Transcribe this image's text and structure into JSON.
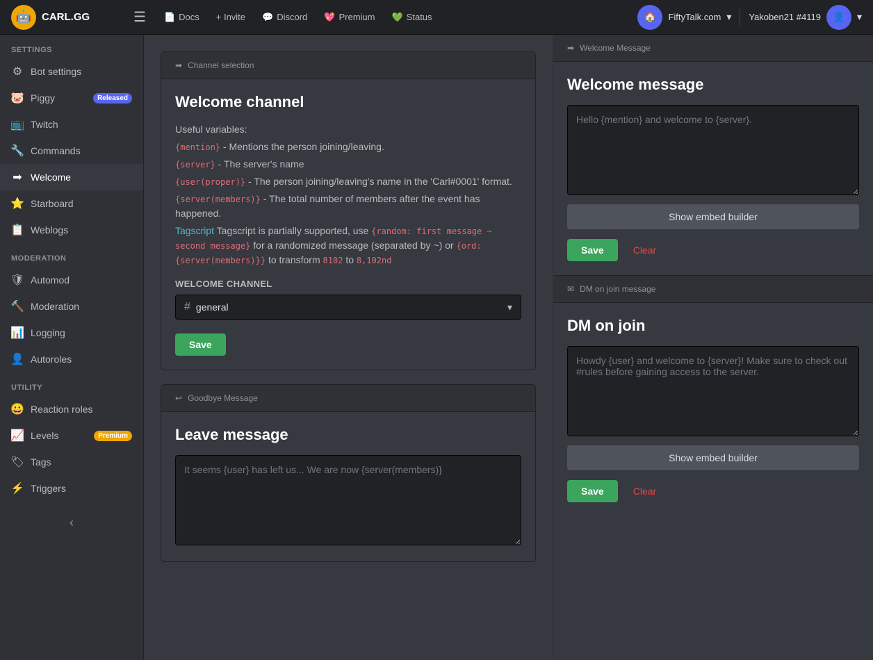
{
  "topnav": {
    "logo_text": "CARL.GG",
    "logo_emoji": "🤖",
    "menu_icon": "☰",
    "links": [
      {
        "label": "Docs",
        "icon": "📄"
      },
      {
        "label": "+ Invite",
        "icon": ""
      },
      {
        "label": "Discord",
        "icon": "💬"
      },
      {
        "label": "Premium",
        "icon": "💖"
      },
      {
        "label": "Status",
        "icon": "💚"
      }
    ],
    "server_name": "FiftyTalk.com",
    "server_icon": "🏠",
    "user_name": "Yakoben21 #4119",
    "user_icon": "👤",
    "chevron": "▾"
  },
  "sidebar": {
    "settings_label": "SETTINGS",
    "items_settings": [
      {
        "label": "Bot settings",
        "icon": "⚙"
      },
      {
        "label": "Piggy",
        "icon": "🐷",
        "badge": "Released"
      },
      {
        "label": "Twitch",
        "icon": "📺"
      },
      {
        "label": "Commands",
        "icon": "🔧"
      },
      {
        "label": "Welcome",
        "icon": "➡",
        "active": true
      },
      {
        "label": "Starboard",
        "icon": "⭐"
      },
      {
        "label": "Weblogs",
        "icon": "📋"
      }
    ],
    "moderation_label": "MODERATION",
    "items_moderation": [
      {
        "label": "Automod",
        "icon": "🛡"
      },
      {
        "label": "Moderation",
        "icon": "🔨"
      },
      {
        "label": "Logging",
        "icon": "📊"
      },
      {
        "label": "Autoroles",
        "icon": "👤"
      }
    ],
    "utility_label": "UTILITY",
    "items_utility": [
      {
        "label": "Reaction roles",
        "icon": "😀"
      },
      {
        "label": "Levels",
        "icon": "📈",
        "badge": "Premium",
        "badge_class": "premium"
      },
      {
        "label": "Tags",
        "icon": "🏷"
      },
      {
        "label": "Triggers",
        "icon": "⚡"
      }
    ],
    "collapse_icon": "‹"
  },
  "left_panel": {
    "channel_selection_header": "Channel selection",
    "welcome_channel_title": "Welcome channel",
    "useful_vars_title": "Useful variables:",
    "vars": [
      {
        "tag": "{mention}",
        "desc": " - Mentions the person joining/leaving."
      },
      {
        "tag": "{server}",
        "desc": " - The server's name"
      },
      {
        "tag": "{user(proper)}",
        "desc": " - The person joining/leaving's name in the 'Carl#0001' format."
      },
      {
        "tag": "{server(members)}",
        "desc": " - The total number of members after the event has happened."
      }
    ],
    "tagscript_note": "Tagscript is partially supported, use ",
    "tagscript_example": "{random: first message ~ second message}",
    "tagscript_mid": " for a randomized message (separated by ~) or ",
    "tagscript_example2": "{ord: {server(members)}}",
    "tagscript_end": " to transform ",
    "tagscript_num1": "8102",
    "tagscript_to": " to ",
    "tagscript_num2": "8,102nd",
    "welcome_channel_label": "Welcome Channel",
    "welcome_channel_value": "general",
    "save_channel_label": "Save",
    "goodbye_message_header": "Goodbye Message",
    "leave_message_title": "Leave message",
    "leave_message_placeholder": "It seems {user} has left us... We are now {server(members)}"
  },
  "right_panel": {
    "welcome_message_header": "Welcome Message",
    "welcome_message_title": "Welcome message",
    "welcome_message_placeholder": "Hello {mention} and welcome to {server}.",
    "show_embed_builder_label": "Show embed builder",
    "save_label": "Save",
    "clear_label": "Clear",
    "dm_message_header": "DM on join message",
    "dm_message_title": "DM on join",
    "dm_message_placeholder": "Howdy {user} and welcome to {server}! Make sure to check out #rules before gaining access to the server.",
    "show_embed_builder_label2": "Show embed builder",
    "save_label2": "Save",
    "clear_label2": "Clear"
  }
}
